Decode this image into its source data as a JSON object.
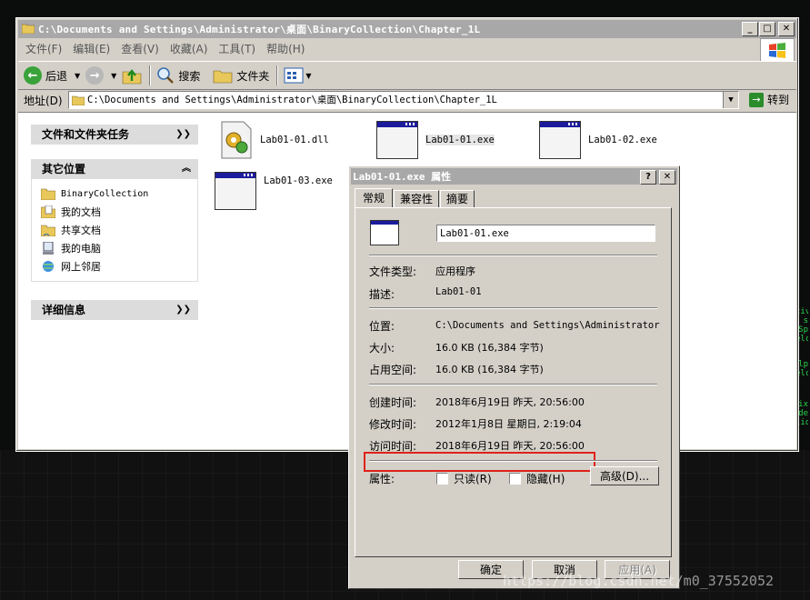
{
  "explorer": {
    "title": "C:\\Documents and Settings\\Administrator\\桌面\\BinaryCollection\\Chapter_1L",
    "menu": [
      "文件(F)",
      "编辑(E)",
      "查看(V)",
      "收藏(A)",
      "工具(T)",
      "帮助(H)"
    ],
    "toolbar": {
      "back": "后退",
      "search": "搜索",
      "folders": "文件夹"
    },
    "address_label": "地址(D)",
    "address_value": "C:\\Documents and Settings\\Administrator\\桌面\\BinaryCollection\\Chapter_1L",
    "go_label": "转到",
    "tasks_header": "文件和文件夹任务",
    "other_header": "其它位置",
    "other_items": [
      "BinaryCollection",
      "我的文档",
      "共享文档",
      "我的电脑",
      "网上邻居"
    ],
    "details_header": "详细信息",
    "files": [
      "Lab01-01.dll",
      "Lab01-01.exe",
      "Lab01-02.exe",
      "Lab01-03.exe"
    ]
  },
  "dialog": {
    "title": "Lab01-01.exe 属性",
    "tabs": [
      "常规",
      "兼容性",
      "摘要"
    ],
    "filename": "Lab01-01.exe",
    "rows": {
      "type_label": "文件类型:",
      "type_value": "应用程序",
      "desc_label": "描述:",
      "desc_value": "Lab01-01",
      "location_label": "位置:",
      "location_value": "C:\\Documents and Settings\\Administrator\\桌",
      "size_label": "大小:",
      "size_value": "16.0 KB (16,384 字节)",
      "disk_label": "占用空间:",
      "disk_value": "16.0 KB (16,384 字节)",
      "created_label": "创建时间:",
      "created_value": "2018年6月19日 昨天, 20:56:00",
      "modified_label": "修改时间:",
      "modified_value": "2012年1月8日 星期日, 2:19:04",
      "accessed_label": "访问时间:",
      "accessed_value": "2018年6月19日 昨天, 20:56:00",
      "attr_label": "属性:"
    },
    "attrs": {
      "readonly": "只读(R)",
      "hidden": "隐藏(H)",
      "advanced": "高级(D)..."
    },
    "buttons": {
      "ok": "确定",
      "cancel": "取消",
      "apply": "应用(A)"
    }
  },
  "watermark": "https://blog.csdn.net/m0_37552052",
  "desktop_text": [
    "tiv",
    "s Sp",
    "elc",
    "lp",
    "elc",
    "ix",
    "de",
    "lid"
  ]
}
